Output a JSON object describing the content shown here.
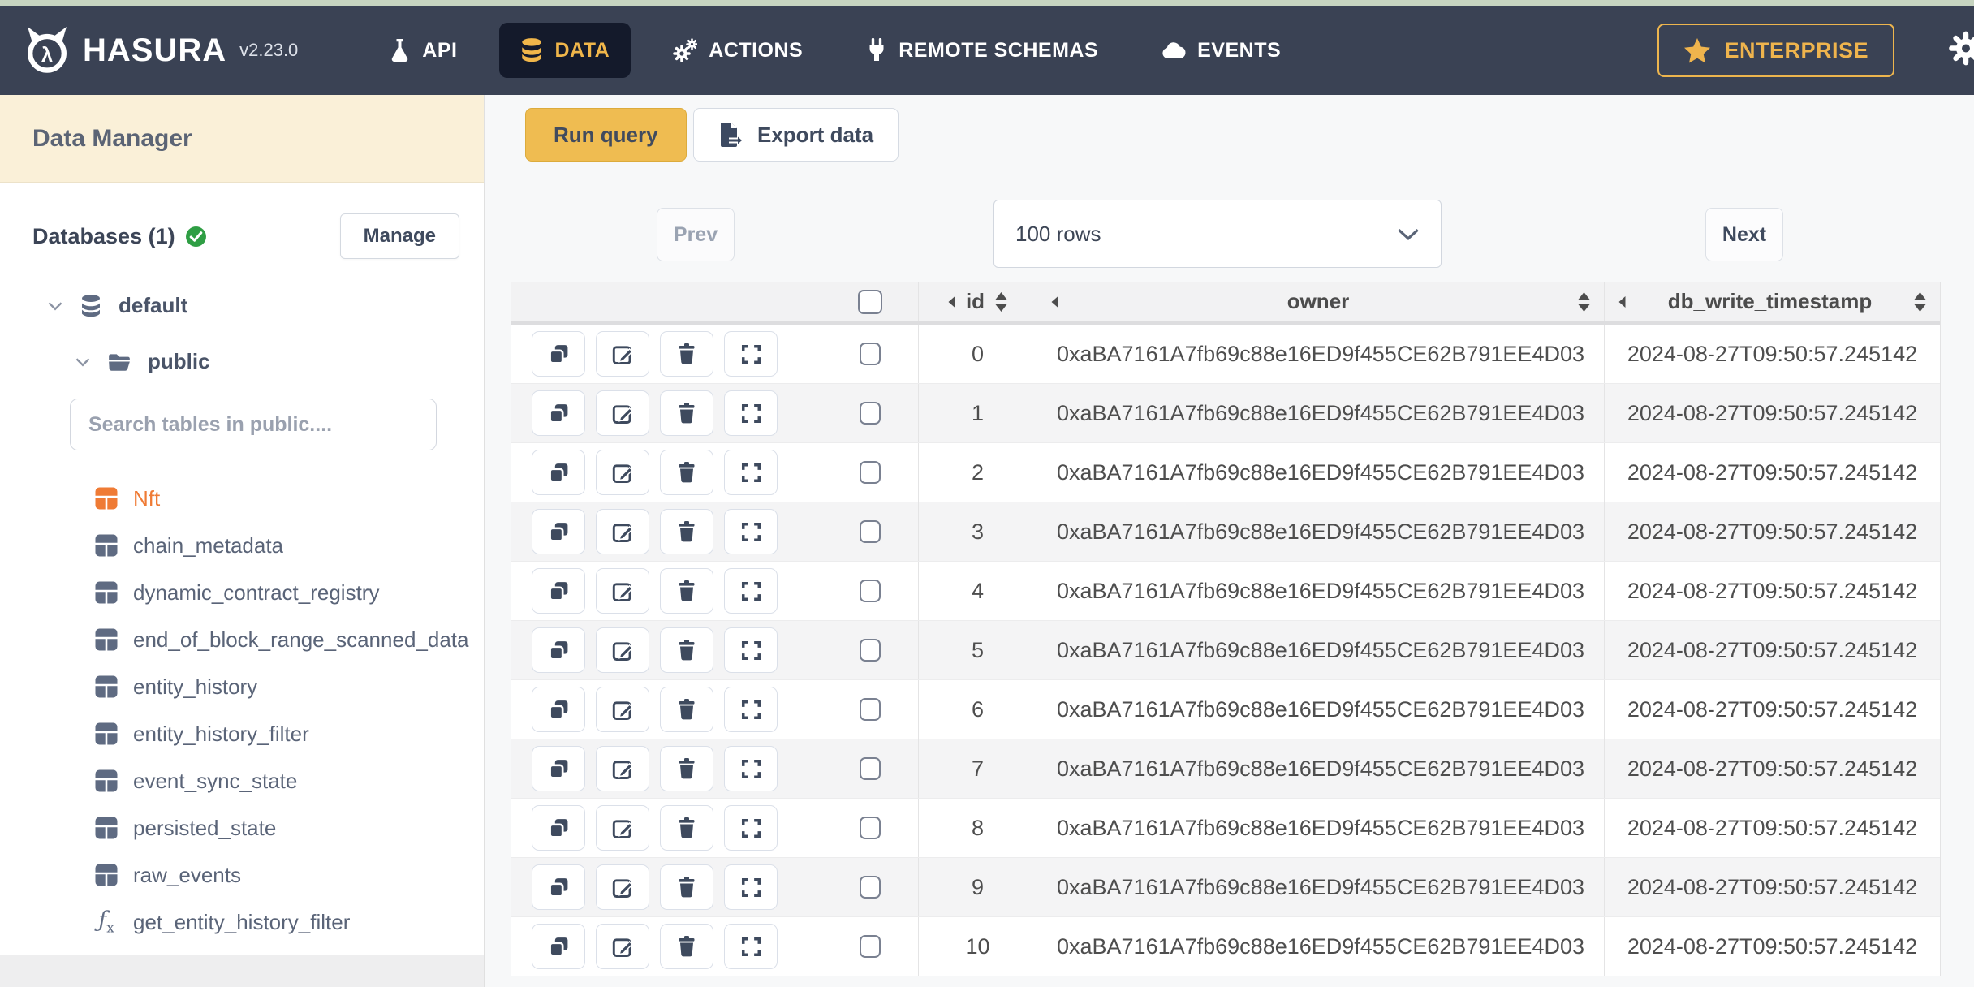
{
  "topbar": {
    "brand": "HASURA",
    "version": "v2.23.0",
    "tabs": [
      {
        "label": "API",
        "icon": "flask-icon"
      },
      {
        "label": "DATA",
        "icon": "database-icon"
      },
      {
        "label": "ACTIONS",
        "icon": "gears-icon"
      },
      {
        "label": "REMOTE SCHEMAS",
        "icon": "plug-icon"
      },
      {
        "label": "EVENTS",
        "icon": "cloud-icon"
      }
    ],
    "active_tab": "DATA",
    "enterprise_label": "ENTERPRISE"
  },
  "sidebar": {
    "title": "Data Manager",
    "databases_label": "Databases (1)",
    "manage_button": "Manage",
    "tree": {
      "database": "default",
      "schema": "public"
    },
    "search_placeholder": "Search tables in public....",
    "tables": [
      {
        "label": "Nft",
        "type": "table",
        "active": true
      },
      {
        "label": "chain_metadata",
        "type": "table",
        "active": false
      },
      {
        "label": "dynamic_contract_registry",
        "type": "table",
        "active": false
      },
      {
        "label": "end_of_block_range_scanned_data",
        "type": "table",
        "active": false
      },
      {
        "label": "entity_history",
        "type": "table",
        "active": false
      },
      {
        "label": "entity_history_filter",
        "type": "table",
        "active": false
      },
      {
        "label": "event_sync_state",
        "type": "table",
        "active": false
      },
      {
        "label": "persisted_state",
        "type": "table",
        "active": false
      },
      {
        "label": "raw_events",
        "type": "table",
        "active": false
      },
      {
        "label": "get_entity_history_filter",
        "type": "function",
        "active": false
      }
    ]
  },
  "main": {
    "run_query_label": "Run query",
    "export_data_label": "Export data",
    "prev_label": "Prev",
    "next_label": "Next",
    "rows_selector_value": "100 rows",
    "table": {
      "columns": [
        "id",
        "owner",
        "db_write_timestamp"
      ],
      "rows": [
        {
          "id": "0",
          "owner": "0xaBA7161A7fb69c88e16ED9f455CE62B791EE4D03",
          "db_write_timestamp": "2024-08-27T09:50:57.245142"
        },
        {
          "id": "1",
          "owner": "0xaBA7161A7fb69c88e16ED9f455CE62B791EE4D03",
          "db_write_timestamp": "2024-08-27T09:50:57.245142"
        },
        {
          "id": "2",
          "owner": "0xaBA7161A7fb69c88e16ED9f455CE62B791EE4D03",
          "db_write_timestamp": "2024-08-27T09:50:57.245142"
        },
        {
          "id": "3",
          "owner": "0xaBA7161A7fb69c88e16ED9f455CE62B791EE4D03",
          "db_write_timestamp": "2024-08-27T09:50:57.245142"
        },
        {
          "id": "4",
          "owner": "0xaBA7161A7fb69c88e16ED9f455CE62B791EE4D03",
          "db_write_timestamp": "2024-08-27T09:50:57.245142"
        },
        {
          "id": "5",
          "owner": "0xaBA7161A7fb69c88e16ED9f455CE62B791EE4D03",
          "db_write_timestamp": "2024-08-27T09:50:57.245142"
        },
        {
          "id": "6",
          "owner": "0xaBA7161A7fb69c88e16ED9f455CE62B791EE4D03",
          "db_write_timestamp": "2024-08-27T09:50:57.245142"
        },
        {
          "id": "7",
          "owner": "0xaBA7161A7fb69c88e16ED9f455CE62B791EE4D03",
          "db_write_timestamp": "2024-08-27T09:50:57.245142"
        },
        {
          "id": "8",
          "owner": "0xaBA7161A7fb69c88e16ED9f455CE62B791EE4D03",
          "db_write_timestamp": "2024-08-27T09:50:57.245142"
        },
        {
          "id": "9",
          "owner": "0xaBA7161A7fb69c88e16ED9f455CE62B791EE4D03",
          "db_write_timestamp": "2024-08-27T09:50:57.245142"
        },
        {
          "id": "10",
          "owner": "0xaBA7161A7fb69c88e16ED9f455CE62B791EE4D03",
          "db_write_timestamp": "2024-08-27T09:50:57.245142"
        }
      ]
    }
  },
  "colors": {
    "navbar_bg": "#3a4254",
    "accent_gold": "#f0b64a",
    "active_orange": "#ef7b35",
    "success_green": "#2f9e44",
    "sidebar_header_bg": "#faf0d8"
  }
}
